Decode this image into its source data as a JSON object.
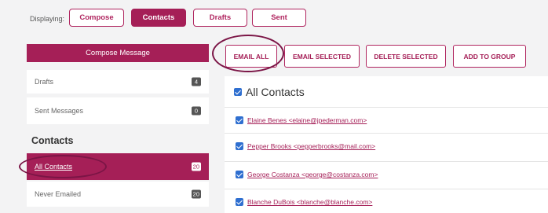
{
  "toolbar": {
    "displaying_label": "Displaying:",
    "tabs": [
      {
        "label": "Compose",
        "active": false
      },
      {
        "label": "Contacts",
        "active": true
      },
      {
        "label": "Drafts",
        "active": false
      },
      {
        "label": "Sent",
        "active": false
      }
    ]
  },
  "sidebar": {
    "compose_label": "Compose Message",
    "folders": [
      {
        "label": "Drafts",
        "count": "4"
      },
      {
        "label": "Sent Messages",
        "count": "0"
      }
    ],
    "contacts_heading": "Contacts",
    "contact_groups": [
      {
        "label": "All Contacts",
        "count": "20",
        "active": true
      },
      {
        "label": "Never Emailed",
        "count": "20",
        "active": false
      }
    ]
  },
  "actions": {
    "email_all": "EMAIL ALL",
    "email_selected": "EMAIL SELECTED",
    "delete_selected": "DELETE SELECTED",
    "add_to_group": "ADD TO GROUP"
  },
  "contacts_panel": {
    "title": "All Contacts",
    "contacts": [
      {
        "display": "Elaine   Benes   <elaine@jpederman.com>"
      },
      {
        "display": "Pepper   Brooks   <pepperbrooks@mail.com>"
      },
      {
        "display": "George   Costanza   <george@costanza.com>"
      },
      {
        "display": "Blanche   DuBois   <blanche@blanche.com>"
      }
    ]
  },
  "colors": {
    "accent": "#a51f57",
    "annotation_ring": "#7b1546",
    "checkbox": "#2f6fd0"
  }
}
